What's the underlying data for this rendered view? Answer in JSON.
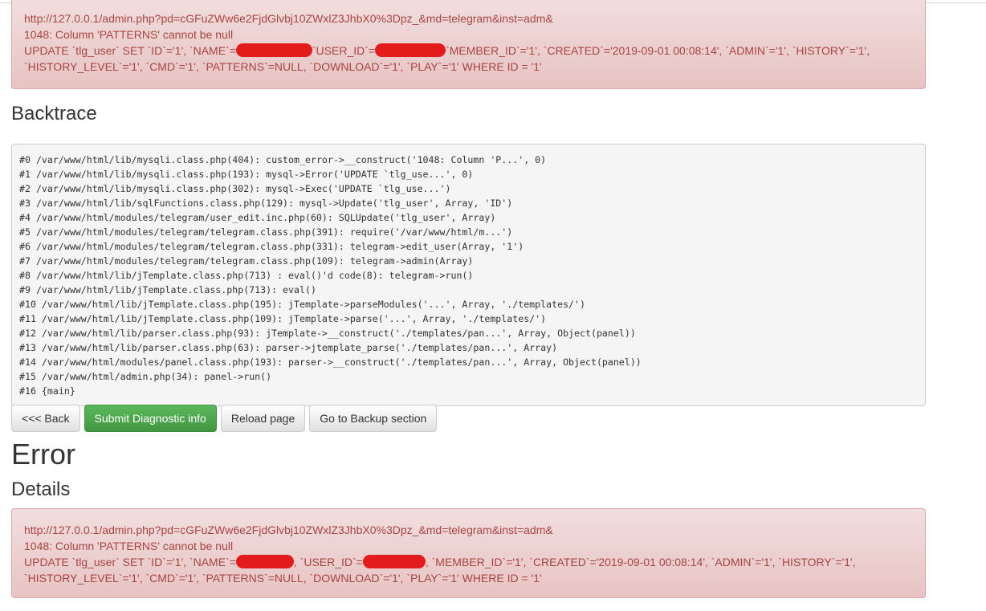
{
  "top_alert": {
    "url": "http://127.0.0.1/admin.php?pd=cGFuZWw6e2FjdGlvbj10ZWxlZ3JhbX0%3Dpz_&md=telegram&inst=adm&",
    "error": "1048: Column 'PATTERNS' cannot be null",
    "sql_part1": "UPDATE `tlg_user` SET `ID`='1', `NAME`=",
    "sql_part2": "`USER_ID`=",
    "sql_part3": "`MEMBER_ID`='1', `CREATED`='2019-09-01 00:08:14', `ADMIN`='1', `HISTORY`='1',",
    "sql_line2": "`HISTORY_LEVEL`='1', `CMD`='1', `PATTERNS`=NULL, `DOWNLOAD`='1', `PLAY`='1' WHERE ID = '1'"
  },
  "backtrace": {
    "heading": "Backtrace",
    "lines": [
      "#0 /var/www/html/lib/mysqli.class.php(404): custom_error->__construct('1048: Column 'P...', 0)",
      "#1 /var/www/html/lib/mysqli.class.php(193): mysql->Error('UPDATE `tlg_use...', 0)",
      "#2 /var/www/html/lib/mysqli.class.php(302): mysql->Exec('UPDATE `tlg_use...')",
      "#3 /var/www/html/lib/sqlFunctions.class.php(129): mysql->Update('tlg_user', Array, 'ID')",
      "#4 /var/www/html/modules/telegram/user_edit.inc.php(60): SQLUpdate('tlg_user', Array)",
      "#5 /var/www/html/modules/telegram/telegram.class.php(391): require('/var/www/html/m...')",
      "#6 /var/www/html/modules/telegram/telegram.class.php(331): telegram->edit_user(Array, '1')",
      "#7 /var/www/html/modules/telegram/telegram.class.php(109): telegram->admin(Array)",
      "#8 /var/www/html/lib/jTemplate.class.php(713) : eval()'d code(8): telegram->run()",
      "#9 /var/www/html/lib/jTemplate.class.php(713): eval()",
      "#10 /var/www/html/lib/jTemplate.class.php(195): jTemplate->parseModules('...', Array, './templates/')",
      "#11 /var/www/html/lib/jTemplate.class.php(109): jTemplate->parse('...', Array, './templates/')",
      "#12 /var/www/html/lib/parser.class.php(93): jTemplate->__construct('./templates/pan...', Array, Object(panel))",
      "#13 /var/www/html/lib/parser.class.php(63): parser->jtemplate_parse('./templates/pan...', Array)",
      "#14 /var/www/html/modules/panel.class.php(193): parser->__construct('./templates/pan...', Array, Object(panel))",
      "#15 /var/www/html/admin.php(34): panel->run()",
      "#16 {main}"
    ]
  },
  "buttons": {
    "back": "<<< Back",
    "submit": "Submit Diagnostic info",
    "reload": "Reload page",
    "backup": "Go to Backup section"
  },
  "error_heading": "Error",
  "details_heading": "Details",
  "bottom_alert": {
    "url": "http://127.0.0.1/admin.php?pd=cGFuZWw6e2FjdGlvbj10ZWxlZ3JhbX0%3Dpz_&md=telegram&inst=adm&",
    "error": "1048: Column 'PATTERNS' cannot be null",
    "sql_part1": "UPDATE `tlg_user` SET `ID`='1', `NAME`=",
    "sql_part2": ", `USER_ID`=",
    "sql_part3": ", `MEMBER_ID`='1', `CREATED`='2019-09-01 00:08:14', `ADMIN`='1', `HISTORY`='1',",
    "sql_line2": "`HISTORY_LEVEL`='1', `CMD`='1', `PATTERNS`=NULL, `DOWNLOAD`='1', `PLAY`='1' WHERE ID = '1'"
  },
  "colors": {
    "alert_text": "#a94442",
    "redaction": "#e41b1b",
    "success": "#5cb85c"
  }
}
